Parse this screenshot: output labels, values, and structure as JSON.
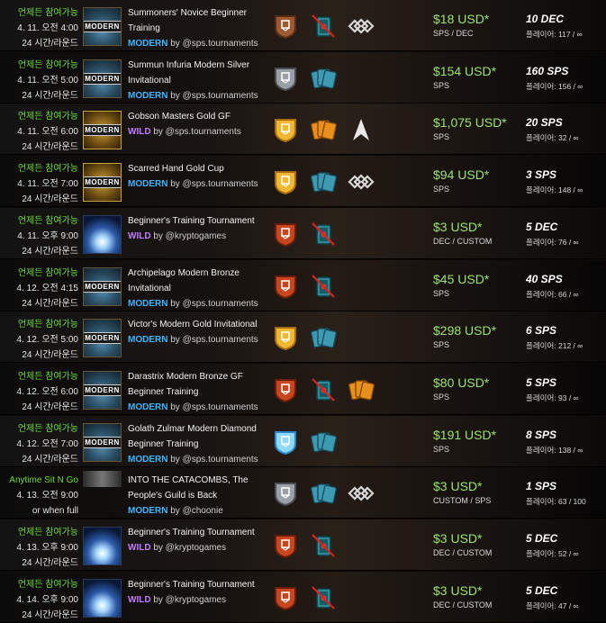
{
  "tournaments": [
    {
      "status": "언제든 참여가능",
      "date": "4. 11. 오전 4:00",
      "round": "24 시간/라운드",
      "thumb": "modern",
      "name": "Summoners' Novice Beginner Training",
      "format": "MODERN",
      "by": "by @sps.tournaments",
      "league": "bronze",
      "edition": "beta",
      "edition_blocked": true,
      "extra": "diamond-rules-icon",
      "prize": "$18 USD*",
      "currency": "SPS / DEC",
      "fee": "10 DEC",
      "players": "플레이어: 117 / ∞"
    },
    {
      "status": "언제든 참여가능",
      "date": "4. 11. 오전 5:00",
      "round": "24 시간/라운드",
      "thumb": "modern",
      "name": "Summun Infuria Modern Silver Invitational",
      "format": "MODERN",
      "by": "by @sps.tournaments",
      "league": "silver",
      "edition": "multi",
      "edition_blocked": false,
      "extra": "",
      "prize": "$154 USD*",
      "currency": "SPS",
      "fee": "160 SPS",
      "players": "플레이어: 156 / ∞"
    },
    {
      "status": "언제든 참여가능",
      "date": "4. 11. 오전 6:00",
      "round": "24 시간/라운드",
      "thumb": "gold",
      "name": "Gobson Masters Gold GF",
      "format": "WILD",
      "by": "by @sps.tournaments",
      "league": "gold",
      "edition": "multi-orange",
      "edition_blocked": false,
      "extra": "arrow-up-icon",
      "prize": "$1,075 USD*",
      "currency": "SPS",
      "fee": "20 SPS",
      "players": "플레이어: 32 / ∞"
    },
    {
      "status": "언제든 참여가능",
      "date": "4. 11. 오전 7:00",
      "round": "24 시간/라운드",
      "thumb": "gold",
      "name": "Scarred Hand Gold Cup",
      "format": "MODERN",
      "by": "by @sps.tournaments",
      "league": "gold",
      "edition": "multi",
      "edition_blocked": false,
      "extra": "diamond-rules-icon",
      "prize": "$94 USD*",
      "currency": "SPS",
      "fee": "3 SPS",
      "players": "플레이어: 148 / ∞"
    },
    {
      "status": "언제든 참여가능",
      "date": "4. 11. 오후 9:00",
      "round": "24 시간/라운드",
      "thumb": "glow",
      "name": "Beginner's Training Tournament",
      "format": "WILD",
      "by": "by @kryptogames",
      "league": "red",
      "edition": "beta",
      "edition_blocked": true,
      "extra": "",
      "prize": "$3 USD*",
      "currency": "DEC / CUSTOM",
      "fee": "5 DEC",
      "players": "플레이어: 76 / ∞"
    },
    {
      "status": "언제든 참여가능",
      "date": "4. 12. 오전 4:15",
      "round": "24 시간/라운드",
      "thumb": "modern",
      "name": "Archipelago Modern Bronze Invitational",
      "format": "MODERN",
      "by": "by @sps.tournaments",
      "league": "red",
      "edition": "beta",
      "edition_blocked": true,
      "extra": "",
      "prize": "$45 USD*",
      "currency": "SPS",
      "fee": "40 SPS",
      "players": "플레이어: 66 / ∞"
    },
    {
      "status": "언제든 참여가능",
      "date": "4. 12. 오전 5:00",
      "round": "24 시간/라운드",
      "thumb": "modern",
      "name": "Victor's Modern Gold Invitational",
      "format": "MODERN",
      "by": "by @sps.tournaments",
      "league": "gold",
      "edition": "multi",
      "edition_blocked": false,
      "extra": "",
      "prize": "$298 USD*",
      "currency": "SPS",
      "fee": "6 SPS",
      "players": "플레이어: 212 / ∞"
    },
    {
      "status": "언제든 참여가능",
      "date": "4. 12. 오전 6:00",
      "round": "24 시간/라운드",
      "thumb": "modern",
      "name": "Darastrix Modern Bronze GF Beginner Training",
      "format": "MODERN",
      "by": "by @sps.tournaments",
      "league": "red",
      "edition": "beta",
      "edition_blocked": true,
      "extra": "multi-orange",
      "prize": "$80 USD*",
      "currency": "SPS",
      "fee": "5 SPS",
      "players": "플레이어: 93 / ∞"
    },
    {
      "status": "언제든 참여가능",
      "date": "4. 12. 오전 7:00",
      "round": "24 시간/라운드",
      "thumb": "modern",
      "name": "Golath Zulmar Modern Diamond Beginner Training",
      "format": "MODERN",
      "by": "by @sps.tournaments",
      "league": "diamond",
      "edition": "multi",
      "edition_blocked": false,
      "extra": "",
      "prize": "$191 USD*",
      "currency": "SPS",
      "fee": "8 SPS",
      "players": "플레이어: 138 / ∞"
    },
    {
      "status": "Anytime Sit N Go",
      "date": "4. 13. 오전 9:00",
      "round": "or when full",
      "thumb": "dark",
      "name": "INTO THE CATACOMBS, The People's Guild is Back",
      "format": "MODERN",
      "by": "by @choonie",
      "league": "silver",
      "edition": "multi",
      "edition_blocked": false,
      "extra": "diamond-rules-icon",
      "prize": "$3 USD*",
      "currency": "CUSTOM / SPS",
      "fee": "1 SPS",
      "players": "플레이어: 63 / 100"
    },
    {
      "status": "언제든 참여가능",
      "date": "4. 13. 오후 9:00",
      "round": "24 시간/라운드",
      "thumb": "glow",
      "name": "Beginner's Training Tournament",
      "format": "WILD",
      "by": "by @kryptogames",
      "league": "red",
      "edition": "beta",
      "edition_blocked": true,
      "extra": "",
      "prize": "$3 USD*",
      "currency": "DEC / CUSTOM",
      "fee": "5 DEC",
      "players": "플레이어: 52 / ∞"
    },
    {
      "status": "언제든 참여가능",
      "date": "4. 14. 오후 9:00",
      "round": "24 시간/라운드",
      "thumb": "glow",
      "name": "Beginner's Training Tournament",
      "format": "WILD",
      "by": "by @kryptogames",
      "league": "red",
      "edition": "beta",
      "edition_blocked": true,
      "extra": "",
      "prize": "$3 USD*",
      "currency": "DEC / CUSTOM",
      "fee": "5 DEC",
      "players": "플레이어: 47 / ∞"
    }
  ],
  "thumb_badge": "MODERN",
  "colors": {
    "status": "#6ddc3c",
    "prize": "#9be36a",
    "modern": "#3fb6ff",
    "wild": "#c27cff"
  }
}
